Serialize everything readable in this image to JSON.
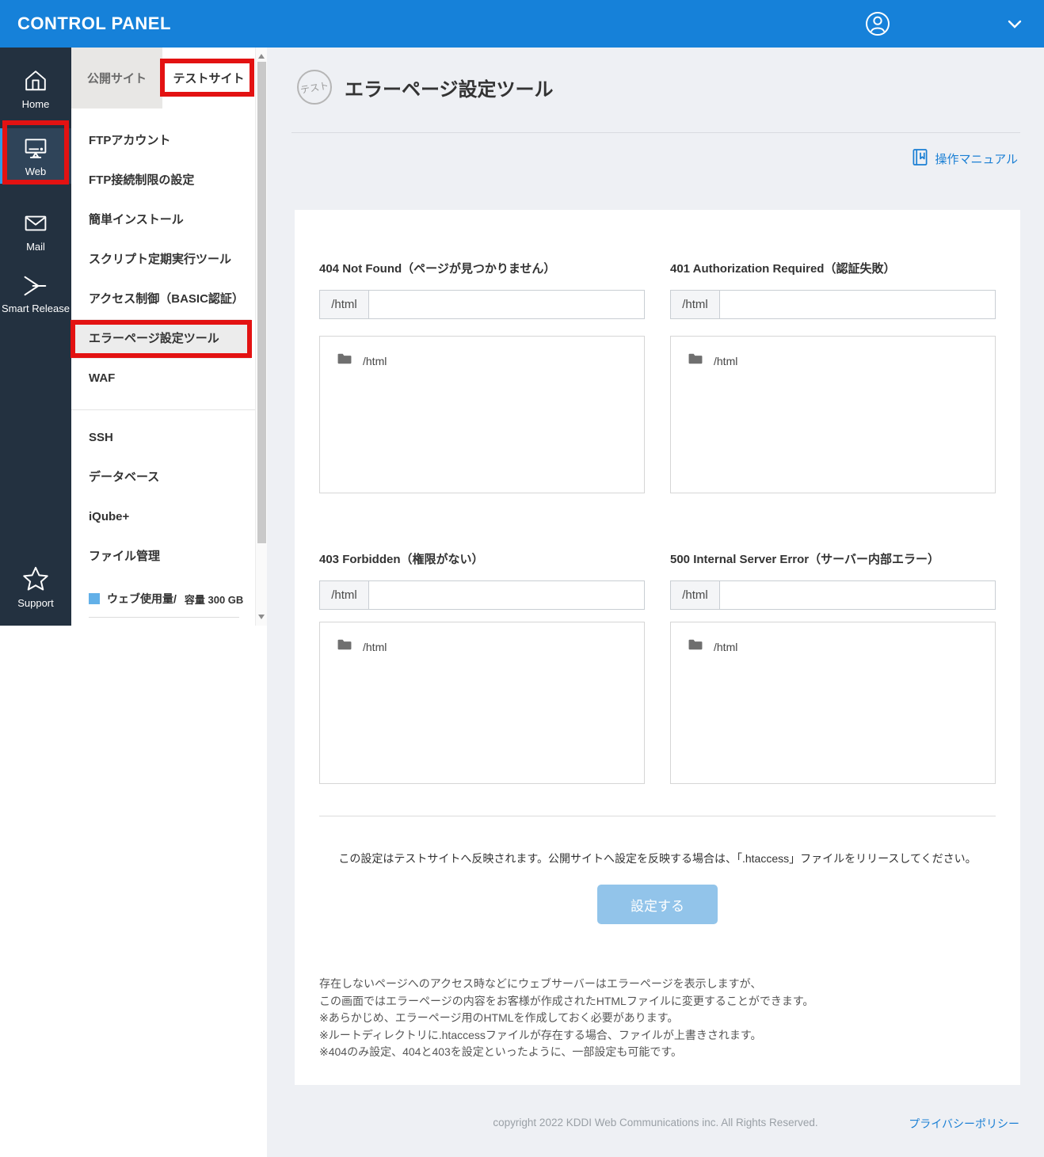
{
  "colors": {
    "header_blue": "#1681d9",
    "rail_dark": "#233140",
    "rail_selected": "#2f4459",
    "rail_accent_bar": "#2e9ce6",
    "annotation_red": "#e31212",
    "link_blue": "#1a7fd4",
    "button_disabled_blue": "#92c4ea",
    "usage_square_blue": "#62b0e8",
    "main_background": "#eef0f4"
  },
  "icons": {
    "user": "user-circle-icon",
    "chevron": "chevron-down-icon",
    "home": "home-icon",
    "web": "monitor-icon",
    "mail": "envelope-icon",
    "smart_release": "double-chevron-icon",
    "support": "star-icon",
    "manual": "book-icon",
    "folder": "folder-icon"
  },
  "header": {
    "title": "CONTROL PANEL"
  },
  "nav_rail": {
    "items": [
      {
        "label": "Home"
      },
      {
        "label": "Web",
        "active": true
      },
      {
        "label": "Mail"
      },
      {
        "label": "Smart Release"
      },
      {
        "label": "Support"
      }
    ]
  },
  "sidebar": {
    "tabs": [
      {
        "label": "公開サイト"
      },
      {
        "label": "テストサイト",
        "active": true
      }
    ],
    "menu_top": [
      "FTPアカウント",
      "FTP接続制限の設定",
      "簡単インストール",
      "スクリプト定期実行ツール",
      "アクセス制御（BASIC認証）",
      "エラーページ設定ツール",
      "WAF"
    ],
    "menu_bottom": [
      "SSH",
      "データベース",
      "iQube+",
      "ファイル管理"
    ],
    "usage_label": "ウェブ使用量/",
    "usage_capacity": "容量 300 GB"
  },
  "main": {
    "badge": "テスト",
    "title": "エラーページ設定ツール",
    "manual_link": "操作マニュアル",
    "sections": [
      {
        "title": "404 Not Found（ページが見つかりません）",
        "prefix": "/html",
        "value": "",
        "tree_item": "/html"
      },
      {
        "title": "401 Authorization Required（認証失敗）",
        "prefix": "/html",
        "value": "",
        "tree_item": "/html"
      },
      {
        "title": "403 Forbidden（権限がない）",
        "prefix": "/html",
        "value": "",
        "tree_item": "/html"
      },
      {
        "title": "500 Internal Server Error（サーバー内部エラー）",
        "prefix": "/html",
        "value": "",
        "tree_item": "/html"
      }
    ],
    "notice": "この設定はテストサイトへ反映されます。公開サイトへ設定を反映する場合は、「.htaccess」ファイルをリリースしてください。",
    "submit_label": "設定する",
    "notes": [
      "存在しないページへのアクセス時などにウェブサーバーはエラーページを表示しますが、",
      "この画面ではエラーページの内容をお客様が作成されたHTMLファイルに変更することができます。",
      "※あらかじめ、エラーページ用のHTMLを作成しておく必要があります。",
      "※ルートディレクトリに.htaccessファイルが存在する場合、ファイルが上書きされます。",
      "※404のみ設定、404と403を設定といったように、一部設定も可能です。"
    ]
  },
  "footer": {
    "copyright": "copyright 2022 KDDI Web Communications inc. All Rights Reserved.",
    "privacy_link": "プライバシーポリシー"
  }
}
